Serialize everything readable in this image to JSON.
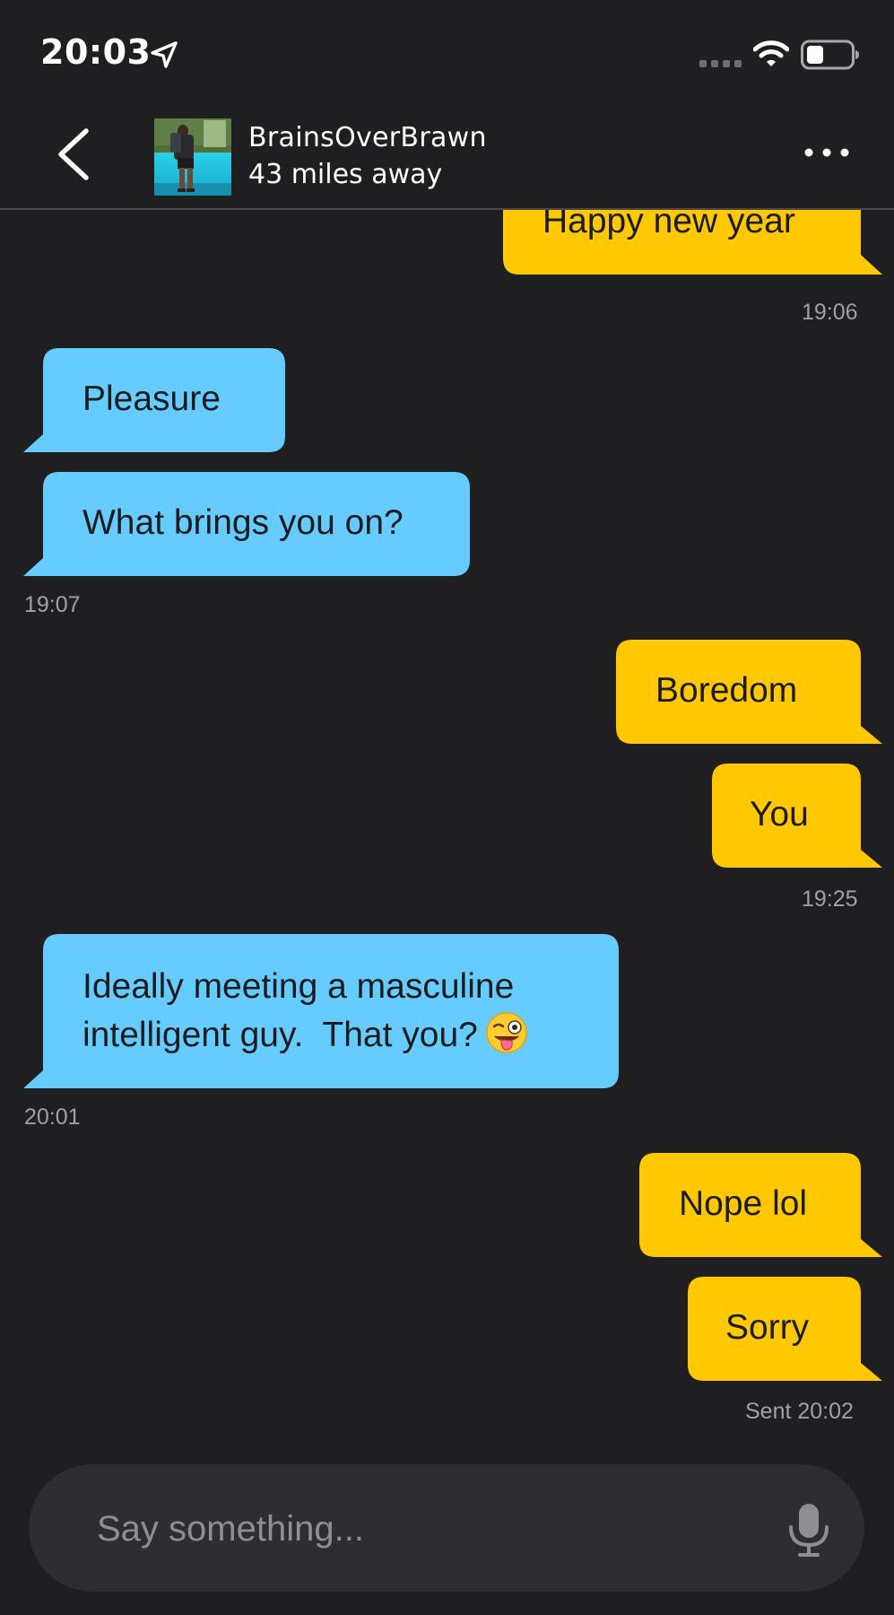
{
  "status_bar": {
    "time": "20:03",
    "icons": [
      "location-arrow-icon",
      "cellular-signal-icon",
      "wifi-icon",
      "battery-icon"
    ]
  },
  "header": {
    "name": "BrainsOverBrawn",
    "distance": "43 miles away",
    "icons": [
      "chevron-left-icon",
      "more-dots-icon"
    ]
  },
  "messages": [
    {
      "id": "m1",
      "direction": "sent",
      "text": "Happy new year"
    },
    {
      "id": "t1",
      "kind": "timestamp",
      "text": "19:06"
    },
    {
      "id": "m2",
      "direction": "received",
      "text": "Pleasure"
    },
    {
      "id": "m3",
      "direction": "received",
      "text": "What brings you on?"
    },
    {
      "id": "t2",
      "kind": "timestamp",
      "text": "19:07"
    },
    {
      "id": "m4",
      "direction": "sent",
      "text": "Boredom"
    },
    {
      "id": "m5",
      "direction": "sent",
      "text": "You"
    },
    {
      "id": "t3",
      "kind": "timestamp",
      "text": "19:25"
    },
    {
      "id": "m6",
      "direction": "received",
      "line1": "Ideally meeting a masculine",
      "line2": "intelligent guy.  That you?",
      "emoji": "winking-face-with-tongue"
    },
    {
      "id": "t4",
      "kind": "timestamp",
      "text": "20:01"
    },
    {
      "id": "m7",
      "direction": "sent",
      "text": "Nope lol"
    },
    {
      "id": "m8",
      "direction": "sent",
      "text": "Sorry"
    },
    {
      "id": "t5",
      "kind": "timestamp",
      "text": "Sent 20:02"
    }
  ],
  "composer": {
    "placeholder": "Say something...",
    "icon": "microphone-icon"
  },
  "colors": {
    "background": "#1f1f21",
    "sent_bubble": "#ffc800",
    "received_bubble": "#66ccff",
    "timestamp": "#a0a0a5",
    "input_bar": "#2e2e31"
  }
}
